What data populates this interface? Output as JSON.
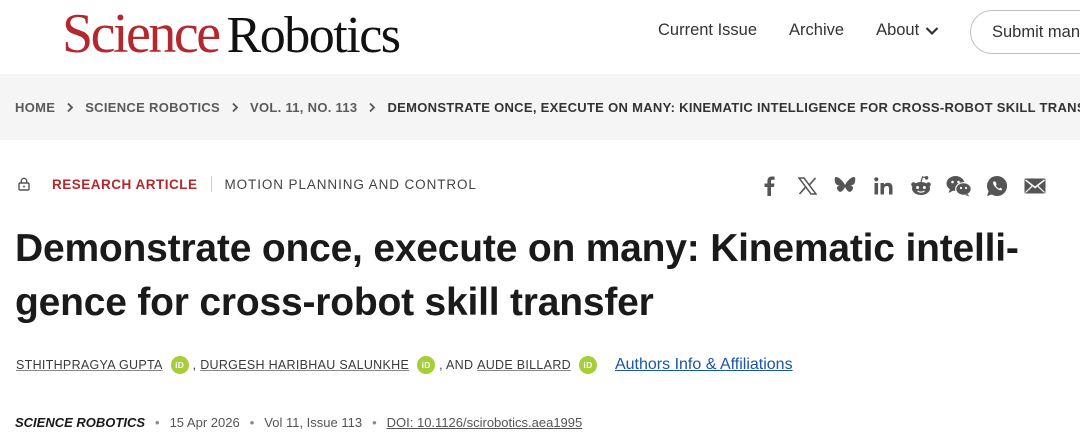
{
  "header": {
    "logo_science": "Science",
    "logo_robotics": "Robotics",
    "nav": [
      "Current Issue",
      "Archive",
      "About"
    ],
    "submit_label": "Submit man"
  },
  "breadcrumb": [
    "HOME",
    "SCIENCE ROBOTICS",
    "VOL. 11, NO. 113",
    "DEMONSTRATE ONCE, EXECUTE ON MANY: KINEMATIC INTELLIGENCE FOR CROSS-ROBOT SKILL TRANSFER"
  ],
  "article": {
    "type": "RESEARCH ARTICLE",
    "topic": "MOTION PLANNING AND CONTROL",
    "title_line1": "Demonstrate once, execute on many: Kinematic intelli-",
    "title_line2": "gence for cross-robot skill transfer",
    "authors": [
      "STHITHPRAGYA GUPTA",
      "DURGESH HARIBHAU SALUNKHE",
      "AUDE BILLARD"
    ],
    "author_sep_1": ",",
    "author_sep_2": ", AND",
    "orcid_label": "iD",
    "affiliations_link": "Authors Info & Affiliations",
    "journal": "SCIENCE ROBOTICS",
    "date": "15 Apr 2026",
    "volume_issue": "Vol 11, Issue 113",
    "doi": "DOI: 10.1126/scirobotics.aea1995"
  },
  "share_icons": [
    "facebook-icon",
    "x-icon",
    "bluesky-icon",
    "linkedin-icon",
    "reddit-icon",
    "wechat-icon",
    "whatsapp-icon",
    "email-icon"
  ],
  "colors": {
    "brand_red": "#b3282d",
    "link_blue": "#1a55a6",
    "orcid_green": "#a6ce39"
  }
}
